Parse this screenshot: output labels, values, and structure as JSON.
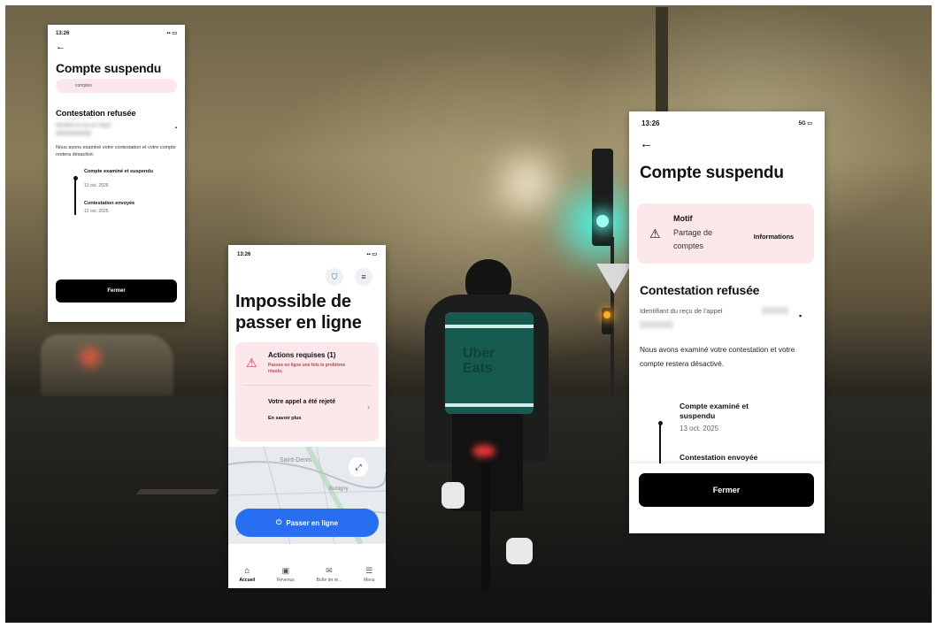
{
  "left_phone": {
    "time": "13:26",
    "title": "Compte suspendu",
    "reason_partial": "comptes",
    "section_title": "Contestation refusée",
    "blurred_id": "Identifiant du reçu de l'appel",
    "body": "Nous avons examiné votre contestation et votre compte restera désactivé.",
    "timeline": [
      {
        "label": "Compte examiné et suspendu",
        "date": "13 oct. 2025"
      },
      {
        "label": "Contestation envoyée",
        "date": "12 oct. 2025"
      }
    ],
    "close_button": "Fermer"
  },
  "middle_phone": {
    "time": "13:26",
    "title": "Impossible de passer en ligne",
    "actions_title": "Actions requises (1)",
    "actions_sub": "Passez en ligne une fois le problème résolu.",
    "appeal_title": "Votre appel a été rejeté",
    "appeal_link": "En savoir plus",
    "map_labels": [
      "Saint-Denis",
      "Bobigny"
    ],
    "online_button": "Passer en ligne",
    "nav": [
      "Accueil",
      "Revenus",
      "Boîte de ré...",
      "Menu"
    ]
  },
  "right_phone": {
    "time": "13:26",
    "signal": "5G",
    "title": "Compte suspendu",
    "reason_label": "Motif",
    "reason_value": "Partage de comptes",
    "info_button": "Informations",
    "section_title": "Contestation refusée",
    "id_label": "Identifiant du reçu de l'appel",
    "body": "Nous avons examiné votre contestation et votre compte restera désactivé.",
    "timeline": [
      {
        "label": "Compte examiné et suspendu",
        "date": "13 oct. 2025"
      },
      {
        "label": "Contestation envoyée",
        "date": ""
      }
    ],
    "close_button": "Fermer"
  },
  "bag_text": [
    "Uber",
    "Eats"
  ],
  "colors": {
    "accent_blue": "#276ef1",
    "alert_red": "#d33a4a",
    "pink_bg": "#fce8ea",
    "traffic_green": "#3fe0d0"
  }
}
